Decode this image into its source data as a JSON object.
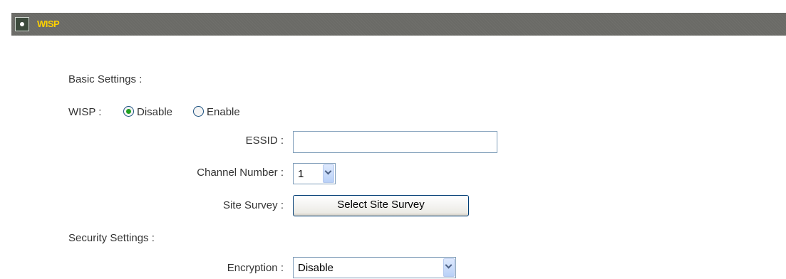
{
  "section": {
    "title": "WISP"
  },
  "basic": {
    "heading": "Basic Settings :",
    "wisp_label": "WISP :",
    "options": [
      "Disable",
      "Enable"
    ],
    "selected": "Disable",
    "essid_label": "ESSID :",
    "essid_value": "",
    "channel_label": "Channel Number :",
    "channel_value": "1",
    "site_survey_label": "Site Survey :",
    "site_survey_button": "Select Site Survey"
  },
  "security": {
    "heading": "Security Settings :",
    "encryption_label": "Encryption :",
    "encryption_value": "Disable"
  },
  "colors": {
    "header_bg": "#6a6a66",
    "header_title": "#ffd200",
    "radio_dot": "#21a121",
    "input_border": "#7f9db9"
  },
  "icons": {
    "header": "radio-dot-icon",
    "dropdown": "chevron-down-icon"
  }
}
